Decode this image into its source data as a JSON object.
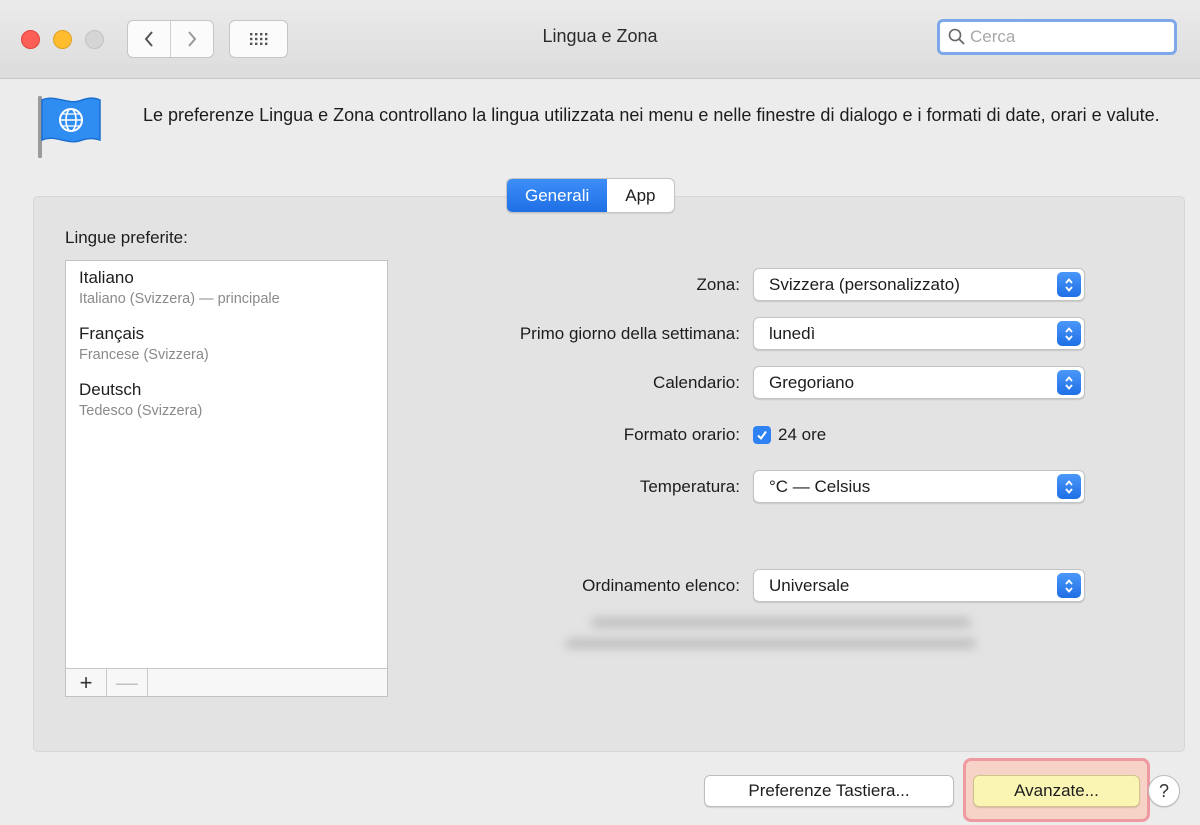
{
  "window": {
    "title": "Lingua e Zona",
    "search_placeholder": "Cerca"
  },
  "header": {
    "description": "Le preferenze Lingua e Zona controllano la lingua utilizzata nei menu e nelle finestre di dialogo e i formati di date, orari e valute.",
    "icon": "globe-flag-icon"
  },
  "tabs": [
    {
      "label": "Generali",
      "active": true
    },
    {
      "label": "App",
      "active": false
    }
  ],
  "languages": {
    "title": "Lingue preferite:",
    "items": [
      {
        "name": "Italiano",
        "detail": "Italiano (Svizzera) — principale"
      },
      {
        "name": "Français",
        "detail": "Francese (Svizzera)"
      },
      {
        "name": "Deutsch",
        "detail": "Tedesco (Svizzera)"
      }
    ],
    "add_label": "+",
    "remove_label": "—"
  },
  "settings": {
    "region": {
      "label": "Zona:",
      "value": "Svizzera (personalizzato)"
    },
    "first_day": {
      "label": "Primo giorno della settimana:",
      "value": "lunedì"
    },
    "calendar": {
      "label": "Calendario:",
      "value": "Gregoriano"
    },
    "time_format": {
      "label": "Formato orario:",
      "checkbox_label": "24 ore",
      "checked": true
    },
    "temperature": {
      "label": "Temperatura:",
      "value": "°C — Celsius"
    },
    "list_sort": {
      "label": "Ordinamento elenco:",
      "value": "Universale"
    }
  },
  "buttons": {
    "keyboard_prefs": "Preferenze Tastiera...",
    "advanced": "Avanzate...",
    "help": "?"
  },
  "colors": {
    "accent": "#1f6fe6",
    "highlight_border": "#ee9aa0",
    "advanced_button_fill": "#fbf5b4"
  }
}
